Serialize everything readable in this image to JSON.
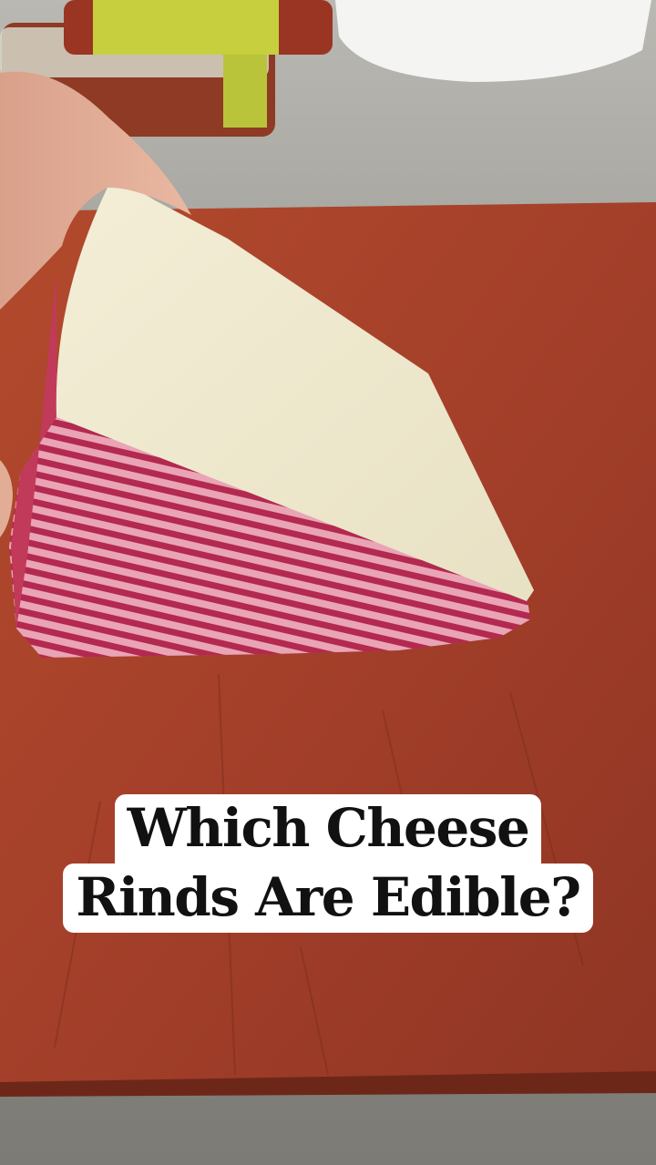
{
  "caption": {
    "line1": "Which Cheese",
    "line2": "Rinds Are Edible?"
  },
  "colors": {
    "board": "#a8432a",
    "rind": "#c84a64",
    "paste": "#f1ecd2",
    "caption_bg": "#ffffff",
    "caption_text": "#111111"
  }
}
